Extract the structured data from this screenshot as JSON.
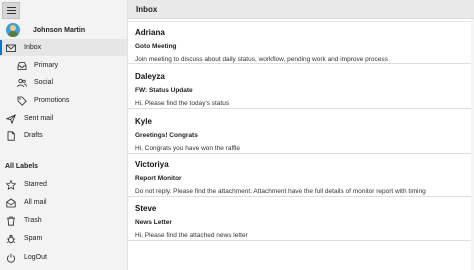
{
  "profile": {
    "name": "Johnson Martin"
  },
  "nav": {
    "inbox": "Inbox",
    "primary": "Primary",
    "social": "Social",
    "promotions": "Promotions",
    "sent": "Sent mail",
    "drafts": "Drafts"
  },
  "labels_section": {
    "title": "All Labels",
    "starred": "Starred",
    "all_mail": "All mail",
    "trash": "Trash",
    "spam": "Spam",
    "logout": "LogOut"
  },
  "header": {
    "title": "Inbox"
  },
  "mails": [
    {
      "sender": "Adriana",
      "subject": "Goto Meeting",
      "preview": "Join meeting to discuss about daily status, workflow, pending work and improve process"
    },
    {
      "sender": "Daleyza",
      "subject": "FW: Status Update",
      "preview": "Hi, Please find the today's status"
    },
    {
      "sender": "Kyle",
      "subject": "Greetings! Congrats",
      "preview": "Hi, Congrats you have won the raffle"
    },
    {
      "sender": "Victoriya",
      "subject": "Report Monitor",
      "preview": "Do not reply. Please find the attachment. Attachment have the full details of monitor report with timing"
    },
    {
      "sender": "Steve",
      "subject": "News Letter",
      "preview": "Hi, Please find the attached news letter"
    }
  ],
  "colors": {
    "accent": "#0078d7",
    "sidebar_bg": "#f3f3f3",
    "header_bg": "#e9e9e9"
  }
}
